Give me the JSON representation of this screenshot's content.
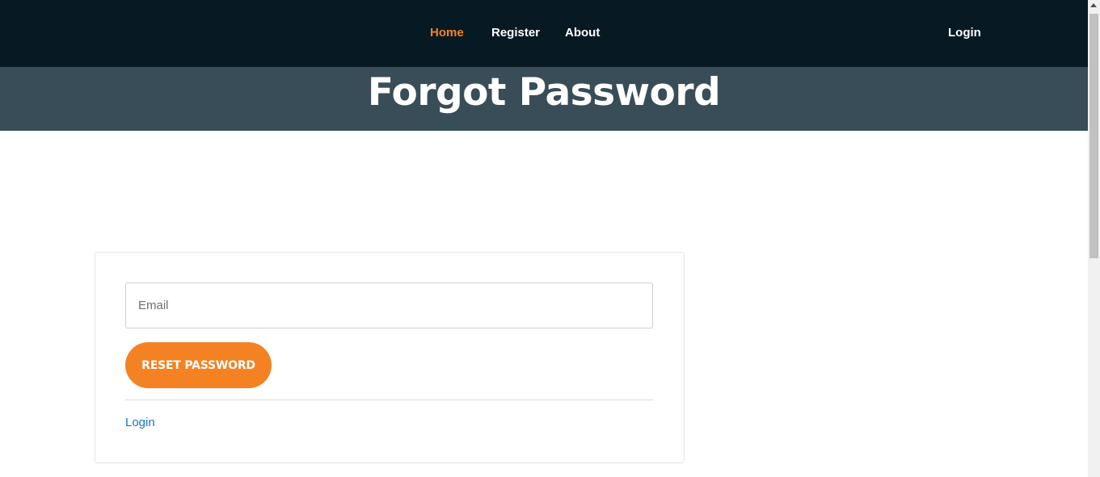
{
  "nav": {
    "home": "Home",
    "register": "Register",
    "about": "About",
    "login": "Login",
    "active_color": "#f58220",
    "background": "#071923"
  },
  "hero": {
    "title": "Forgot Password",
    "background": "#394d58"
  },
  "form": {
    "email_placeholder": "Email",
    "email_value": "",
    "reset_button": "RESET PASSWORD",
    "button_color": "#f48222",
    "login_link": "Login",
    "link_color": "#1a73c8"
  }
}
